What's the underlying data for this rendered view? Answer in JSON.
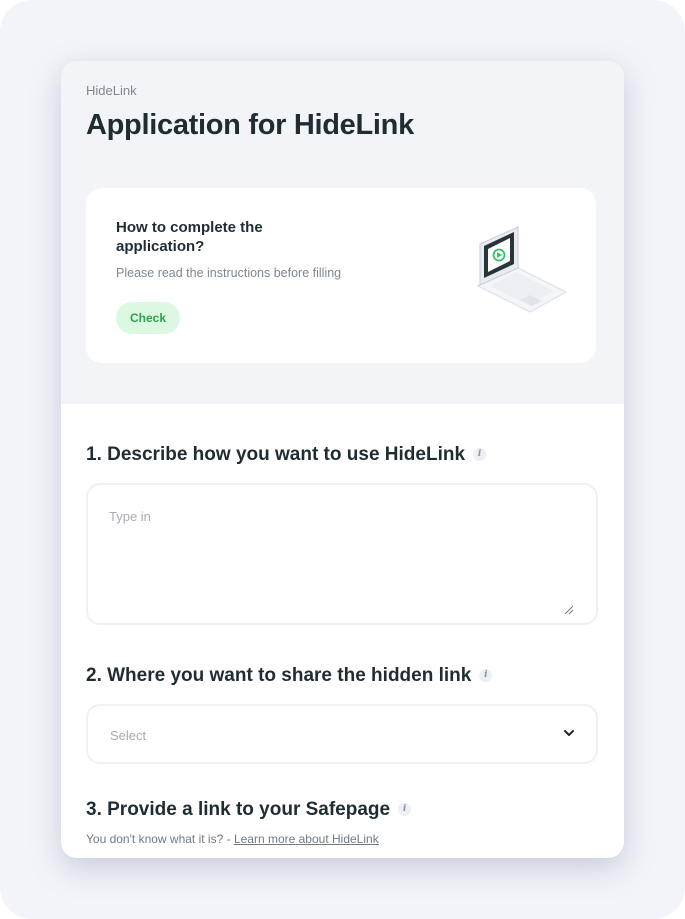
{
  "header": {
    "brand": "HideLink",
    "title": "Application for HideLink"
  },
  "instructions": {
    "title": "How to complete the application?",
    "subtitle": "Please read the instructions before filling",
    "button_label": "Check",
    "illustration": "laptop-illustration"
  },
  "questions": [
    {
      "label": "1. Describe how you want to use HideLink",
      "placeholder": "Type in",
      "value": ""
    },
    {
      "label": "2. Where you want to share the hidden link",
      "select_value": "Select"
    },
    {
      "label": "3. Provide a link to your Safepage",
      "hint_prefix": "You don't know what it is? - ",
      "hint_link": "Learn more about HideLink"
    }
  ],
  "info_icon_glyph": "i",
  "colors": {
    "accent_green": "#2fa24a",
    "accent_green_bg": "#dcf7e2",
    "background": "#f2f4f9",
    "text": "#1f2d33"
  }
}
